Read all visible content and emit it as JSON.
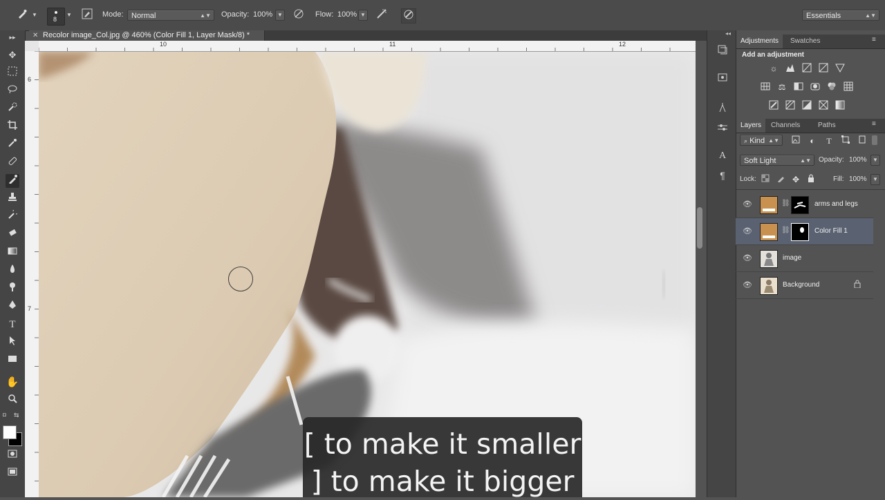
{
  "options_bar": {
    "brush_size": "8",
    "mode_label": "Mode:",
    "mode_value": "Normal",
    "opacity_label": "Opacity:",
    "opacity_value": "100%",
    "flow_label": "Flow:",
    "flow_value": "100%",
    "workspace": "Essentials"
  },
  "document": {
    "tab_title": "Recolor image_Col.jpg @ 460% (Color Fill 1, Layer Mask/8) *",
    "ruler_h": [
      "10",
      "11",
      "12"
    ],
    "ruler_v": [
      "6",
      "7"
    ]
  },
  "adjustments_panel": {
    "tabs": [
      "Adjustments",
      "Swatches"
    ],
    "heading": "Add an adjustment"
  },
  "layers_panel": {
    "tabs": [
      "Layers",
      "Channels",
      "Paths"
    ],
    "filter_kind": "Kind",
    "blend_mode": "Soft Light",
    "opacity_label": "Opacity:",
    "opacity_value": "100%",
    "lock_label": "Lock:",
    "fill_label": "Fill:",
    "fill_value": "100%",
    "layers": [
      {
        "name": "arms and legs",
        "selected": false
      },
      {
        "name": "Color Fill 1",
        "selected": true
      },
      {
        "name": "image",
        "selected": false
      },
      {
        "name": "Background",
        "selected": false
      }
    ],
    "fill_color": "#c8914f"
  },
  "caption": {
    "line1": "[ to make it smaller",
    "line2": "] to make it bigger"
  }
}
